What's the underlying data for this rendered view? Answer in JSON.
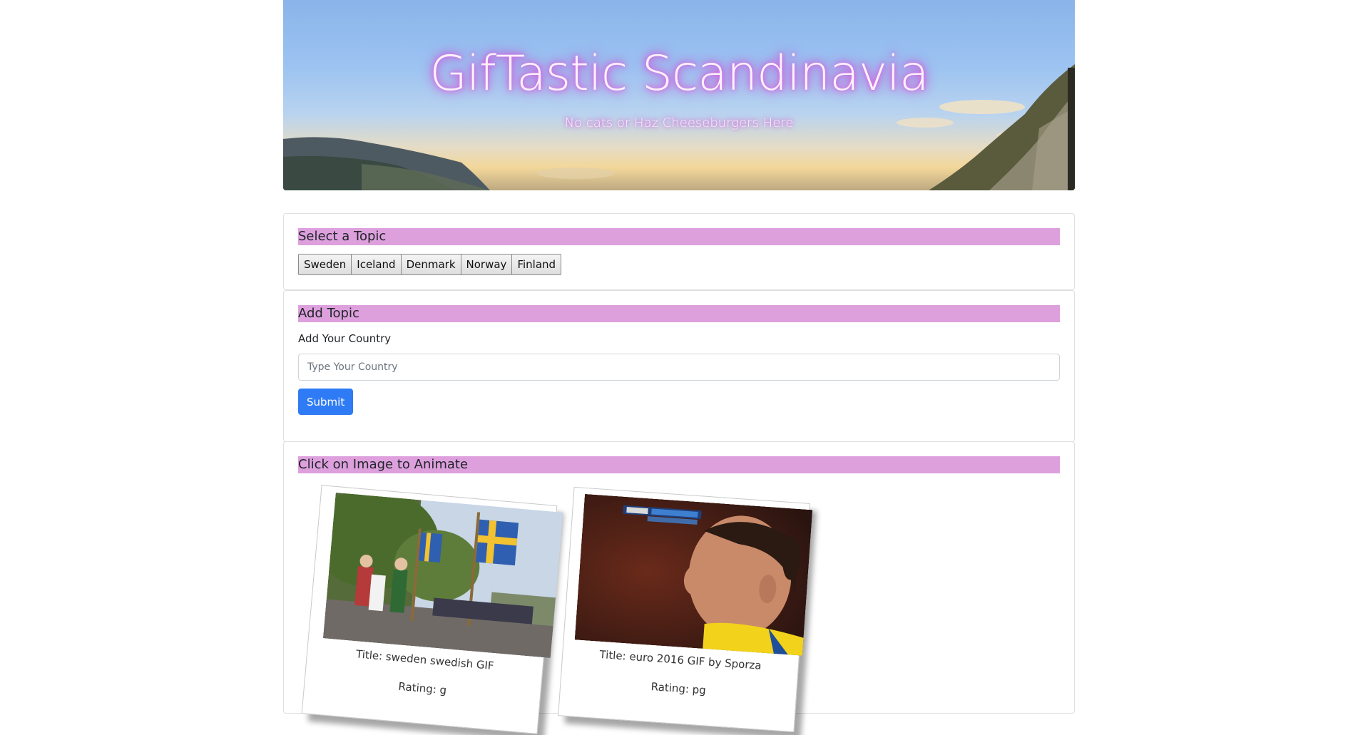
{
  "header": {
    "title": "GifTastic Scandinavia",
    "subtitle": "No cats or Haz Cheeseburgers Here"
  },
  "topics": {
    "heading": "Select a Topic",
    "buttons": [
      "Sweden",
      "Iceland",
      "Denmark",
      "Norway",
      "Finland"
    ]
  },
  "add_topic": {
    "heading": "Add Topic",
    "label": "Add Your Country",
    "placeholder": "Type Your Country",
    "submit_label": "Submit"
  },
  "gifs": {
    "heading": "Click on Image to Animate",
    "items": [
      {
        "title": "Title: sweden swedish GIF",
        "rating": "Rating: g"
      },
      {
        "title": "Title: euro 2016 GIF by Sporza",
        "rating": "Rating: pg"
      }
    ]
  },
  "colors": {
    "heading_bg": "#dda0dd",
    "submit_bg": "#2f7bf5",
    "title_glow": "#d04fd6"
  }
}
